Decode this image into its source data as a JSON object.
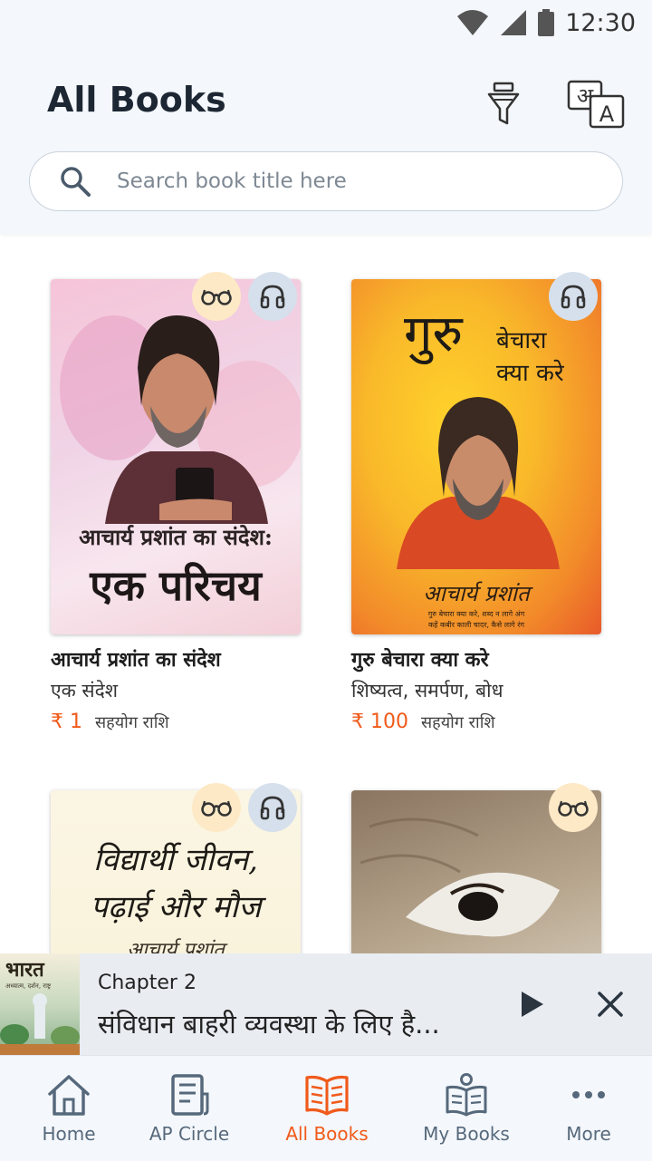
{
  "status_bar": {
    "time": "12:30"
  },
  "header": {
    "title": "All Books"
  },
  "search": {
    "placeholder": "Search book title here"
  },
  "books": [
    {
      "title": "आचार्य प्रशांत का संदेश",
      "subtitle": "एक संदेश",
      "price": "₹ 1",
      "price_label": "सहयोग राशि",
      "cover_line1": "आचार्य प्रशांत का संदेश:",
      "cover_line2": "एक परिचय",
      "badges": [
        "read",
        "listen"
      ]
    },
    {
      "title": "गुरु बेचारा क्या करे",
      "subtitle": "शिष्यत्व, समर्पण, बोध",
      "price": "₹ 100",
      "price_label": "सहयोग राशि",
      "cover_word1": "गुरु",
      "cover_word2": "बेचारा",
      "cover_word3": "क्या करे",
      "cover_author": "आचार्य प्रशांत",
      "cover_tagline1": "गुरु बेचारा क्या करे, शब्द न लागे अंग",
      "cover_tagline2": "कहें कबीर काली चादर, कैसे लागे रंग",
      "badges": [
        "listen"
      ]
    },
    {
      "cover_line1": "विद्यार्थी जीवन,",
      "cover_line2": "पढ़ाई और मौज",
      "cover_author": "आचार्य प्रशांत",
      "badges": [
        "read",
        "listen"
      ]
    },
    {
      "badges": [
        "read"
      ]
    }
  ],
  "player": {
    "thumb_title": "भारत",
    "thumb_subtitle": "अध्यात्म, दर्शन, राष्ट्र",
    "chapter": "Chapter 2",
    "track": "संविधान बाहरी व्यवस्था के लिए है..."
  },
  "nav": {
    "items": [
      {
        "label": "Home",
        "icon": "home-icon"
      },
      {
        "label": "AP Circle",
        "icon": "document-icon"
      },
      {
        "label": "All Books",
        "icon": "open-book-icon"
      },
      {
        "label": "My Books",
        "icon": "reader-icon"
      },
      {
        "label": "More",
        "icon": "more-icon"
      }
    ],
    "active": "All Books"
  },
  "colors": {
    "accent": "#f05a1a",
    "nav_inactive": "#56697c",
    "header_bg": "#f4f7fb"
  }
}
